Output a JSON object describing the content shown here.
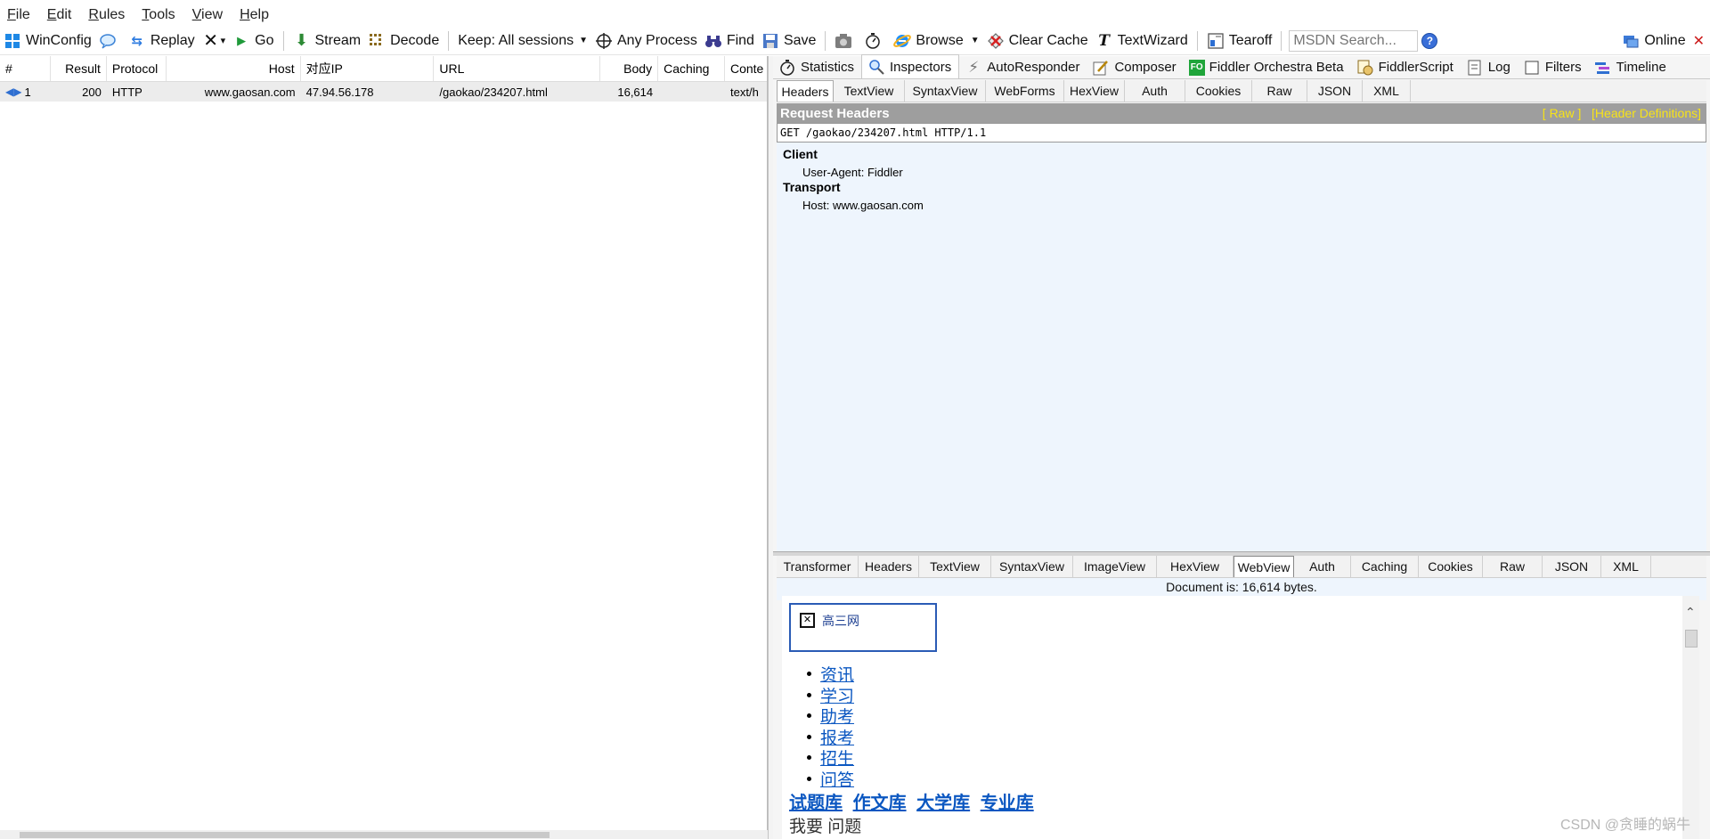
{
  "menu": {
    "items": [
      {
        "ul": "F",
        "rest": "ile"
      },
      {
        "ul": "E",
        "rest": "dit"
      },
      {
        "ul": "R",
        "rest": "ules"
      },
      {
        "ul": "T",
        "rest": "ools"
      },
      {
        "ul": "V",
        "rest": "iew"
      },
      {
        "ul": "H",
        "rest": "elp"
      }
    ]
  },
  "toolbar": {
    "winconfig": "WinConfig",
    "replay": "Replay",
    "remove_caret": "▾",
    "go": "Go",
    "stream": "Stream",
    "decode": "Decode",
    "keep": "Keep: All sessions",
    "any_process": "Any Process",
    "find": "Find",
    "save": "Save",
    "browse": "Browse",
    "clear_cache": "Clear Cache",
    "textwizard": "TextWizard",
    "tearoff": "Tearoff",
    "msdn_placeholder": "MSDN Search...",
    "online": "Online"
  },
  "sessions": {
    "columns": [
      "#",
      "Result",
      "Protocol",
      "Host",
      "对应IP",
      "URL",
      "Body",
      "Caching",
      "Conte"
    ],
    "rows": [
      {
        "num": "1",
        "result": "200",
        "protocol": "HTTP",
        "host": "www.gaosan.com",
        "ip": "47.94.56.178",
        "url": "/gaokao/234207.html",
        "body": "16,614",
        "caching": "",
        "content": "text/h"
      }
    ]
  },
  "inspector_tabs": {
    "statistics": "Statistics",
    "inspectors": "Inspectors",
    "autoresponder": "AutoResponder",
    "composer": "Composer",
    "orchestra": "Fiddler Orchestra Beta",
    "fo_badge": "FO",
    "fiddlerscript": "FiddlerScript",
    "log": "Log",
    "filters": "Filters",
    "timeline": "Timeline"
  },
  "request_tabs": [
    "Headers",
    "TextView",
    "SyntaxView",
    "WebForms",
    "HexView",
    "Auth",
    "Cookies",
    "Raw",
    "JSON",
    "XML"
  ],
  "request": {
    "title": "Request Headers",
    "raw_link": "[ Raw ]",
    "defs_link": "[Header Definitions]",
    "request_line": "GET /gaokao/234207.html HTTP/1.1",
    "groups": [
      {
        "name": "Client",
        "items": [
          "User-Agent: Fiddler"
        ]
      },
      {
        "name": "Transport",
        "items": [
          "Host: www.gaosan.com"
        ]
      }
    ]
  },
  "response_tabs": [
    "Transformer",
    "Headers",
    "TextView",
    "SyntaxView",
    "ImageView",
    "HexView",
    "WebView",
    "Auth",
    "Caching",
    "Cookies",
    "Raw",
    "JSON",
    "XML"
  ],
  "response": {
    "doc_info": "Document is: 16,614 bytes.",
    "logo_alt": "高三网",
    "nav": [
      "资讯",
      "学习",
      "助考",
      "报考",
      "招生",
      "问答"
    ],
    "big_links": [
      "试题库",
      "作文库",
      "大学库",
      "专业库"
    ],
    "cut_text": "我要 问题"
  },
  "watermark": "CSDN @贪睡的蜗牛"
}
